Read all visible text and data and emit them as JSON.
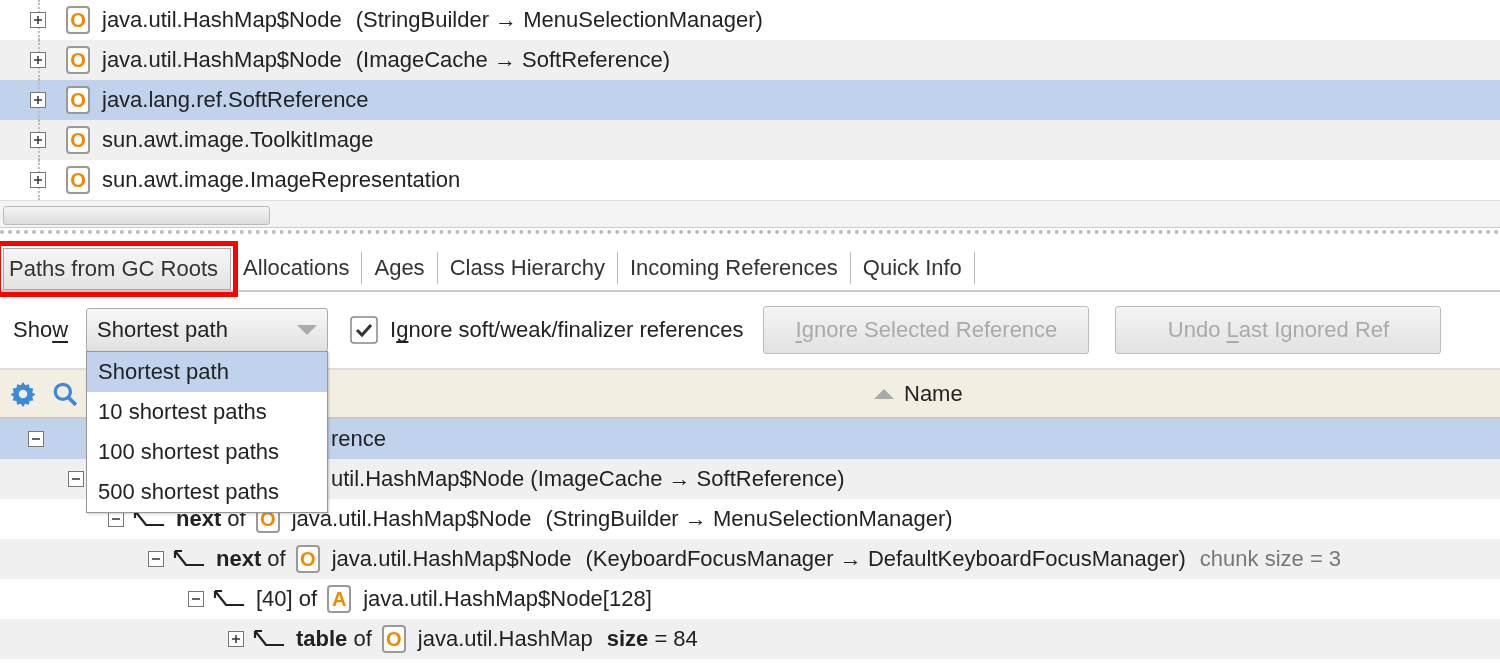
{
  "top_list": {
    "rows": [
      {
        "badge": "O",
        "class": "java.util.HashMap$Node",
        "detail": "(StringBuilder → MenuSelectionManager)",
        "selected": false,
        "expanded": false
      },
      {
        "badge": "O",
        "class": "java.util.HashMap$Node",
        "detail": "(ImageCache → SoftReference)",
        "selected": false,
        "expanded": false
      },
      {
        "badge": "O",
        "class": "java.lang.ref.SoftReference",
        "selected": true,
        "expanded": false
      },
      {
        "badge": "O",
        "class": "sun.awt.image.ToolkitImage",
        "selected": false,
        "expanded": false
      },
      {
        "badge": "O",
        "class": "sun.awt.image.ImageRepresentation",
        "selected": false,
        "expanded": false
      }
    ]
  },
  "tabs": [
    {
      "label": "Paths from GC Roots",
      "selected": true,
      "highlighted": true
    },
    {
      "label": "Allocations",
      "selected": false,
      "highlighted": false
    },
    {
      "label": "Ages",
      "selected": false,
      "highlighted": false
    },
    {
      "label": "Class Hierarchy",
      "selected": false,
      "highlighted": false
    },
    {
      "label": "Incoming References",
      "selected": false,
      "highlighted": false
    },
    {
      "label": "Quick Info",
      "selected": false,
      "highlighted": false
    }
  ],
  "toolbar": {
    "show_label": [
      {
        "text": "Sho",
        "underlined": false
      },
      {
        "text": "w",
        "underlined": true
      }
    ],
    "dropdown": {
      "value": "Shortest path",
      "open": true,
      "options": [
        {
          "label": "Shortest path",
          "selected": true
        },
        {
          "label": "10 shortest paths",
          "selected": false
        },
        {
          "label": "100 shortest paths",
          "selected": false
        },
        {
          "label": "500 shortest paths",
          "selected": false
        }
      ]
    },
    "checkbox": {
      "label": [
        {
          "text": "I",
          "underlined": false
        },
        {
          "text": "g",
          "underlined": true
        },
        {
          "text": "nore soft/weak/finalizer references",
          "underlined": false
        }
      ],
      "checked": true
    },
    "buttons": [
      {
        "label": [
          {
            "text": "I",
            "underlined": true
          },
          {
            "text": "gnore Selected Reference",
            "underlined": false
          }
        ],
        "disabled": true
      },
      {
        "label": [
          {
            "text": "Undo ",
            "underlined": false
          },
          {
            "text": "L",
            "underlined": true
          },
          {
            "text": "ast Ignored Ref",
            "underlined": false
          }
        ],
        "disabled": true
      }
    ]
  },
  "tree": {
    "column": {
      "label": "Name",
      "sort_ascending": true
    },
    "nodes": [
      {
        "kind": "partial",
        "text": "rence",
        "selected": true,
        "expanded": true,
        "children": [
          {
            "kind": "partial",
            "text": "util.HashMap$Node  (ImageCache → SoftReference)",
            "selected": false,
            "expanded": true,
            "children": [
              {
                "kind": "reference",
                "ref": "**next** of",
                "badge": "O",
                "class": "java.util.HashMap$Node",
                "detail": "(StringBuilder → MenuSelectionManager)",
                "selected": false,
                "expanded": true,
                "children": [
                  {
                    "kind": "reference",
                    "ref": "**next** of",
                    "badge": "O",
                    "class": "java.util.HashMap$Node",
                    "detail": "(KeyboardFocusManager → DefaultKeyboardFocusManager)",
                    "note": "chunk size = 3",
                    "selected": false,
                    "expanded": true,
                    "children": [
                      {
                        "kind": "reference",
                        "ref": "[40] of",
                        "badge": "A",
                        "class": "java.util.HashMap$Node[128]",
                        "selected": false,
                        "expanded": true,
                        "children": [
                          {
                            "kind": "reference",
                            "ref": "**table** of",
                            "badge": "O",
                            "class": "java.util.HashMap",
                            "detail": "**size**  =  84",
                            "selected": false,
                            "expanded": false
                          }
                        ]
                      }
                    ]
                  }
                ]
              }
            ]
          }
        ]
      }
    ]
  }
}
